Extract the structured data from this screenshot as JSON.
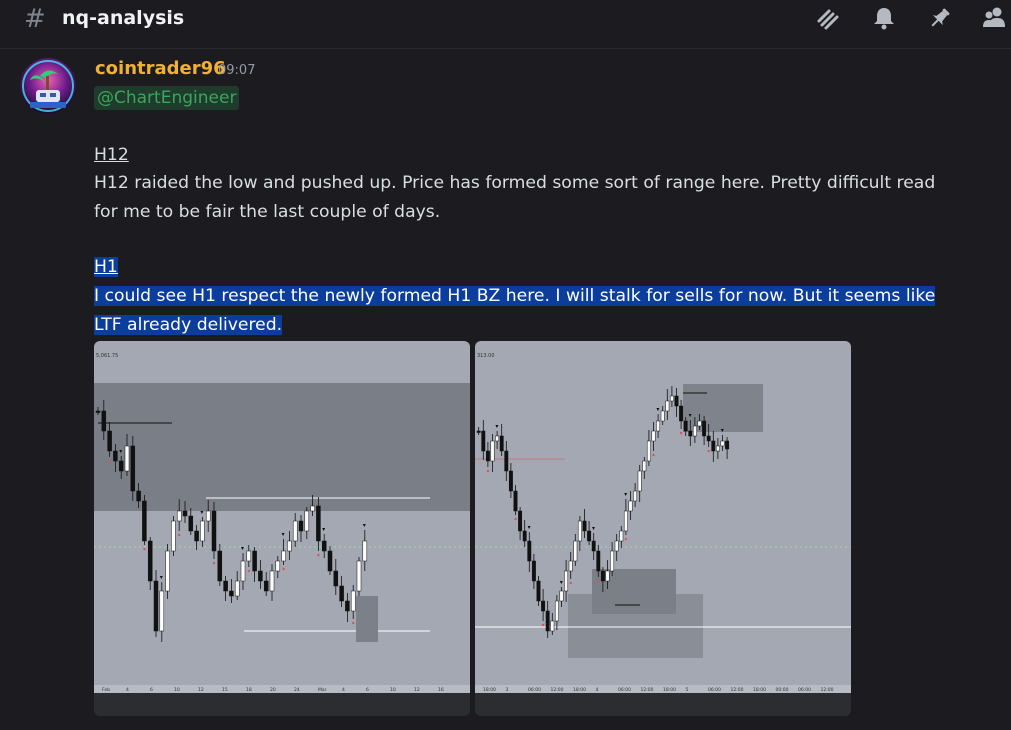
{
  "header": {
    "hash_symbol": "#",
    "channel_name": "nq-analysis"
  },
  "message": {
    "author": "cointrader96",
    "timestamp": "09:07",
    "mention": "@ChartEngineer",
    "section1_title": "H12",
    "section1_line1": "H12 raided the low and pushed up. Price has formed some sort of range here. Pretty difficult read",
    "section1_line2": "for me to be fair the last couple of days.",
    "section2_title": "H1",
    "section2_line1": "I could see H1 respect the newly formed H1 BZ here. I will stalk for sells for now. But it seems like",
    "section2_line2": "LTF already delivered."
  },
  "colors": {
    "background": "#1c1c20",
    "username": "#f0b232",
    "mention_bg": "#1f3b2c",
    "mention_text": "#3ba55c",
    "selection": "#0b3d9c"
  },
  "icons": [
    "threads-icon",
    "bell-icon",
    "pin-icon",
    "members-icon"
  ],
  "attachments": [
    {
      "price_label": "5,061.75",
      "x_ticks": [
        "Feb",
        "4",
        "6",
        "10",
        "12",
        "15",
        "18",
        "20",
        "24",
        "Mar",
        "4",
        "6",
        "10",
        "12",
        "16"
      ]
    },
    {
      "price_label": "313.00",
      "x_ticks": [
        "18:00",
        "3",
        "06:00",
        "12:00",
        "18:00",
        "4",
        "06:00",
        "12:00",
        "18:00",
        "5",
        "06:00",
        "12:00",
        "18:00",
        "00:00",
        "06:00",
        "12:00"
      ]
    }
  ]
}
